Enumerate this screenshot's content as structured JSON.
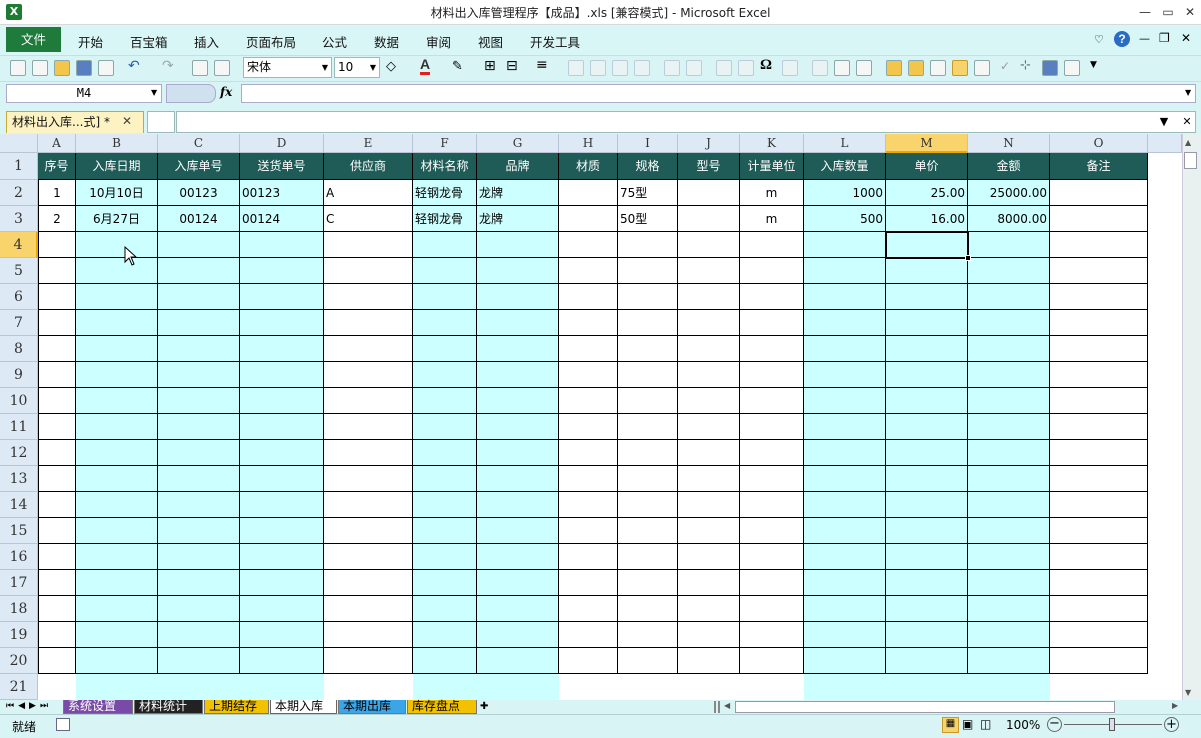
{
  "window": {
    "title": "材料出入库管理程序【成品】.xls  [兼容模式]  -  Microsoft Excel",
    "app_icon": "X"
  },
  "menu": {
    "file": "文件",
    "items": [
      "开始",
      "百宝箱",
      "插入",
      "页面布局",
      "公式",
      "数据",
      "审阅",
      "视图",
      "开发工具"
    ]
  },
  "toolbar": {
    "font_name": "宋体",
    "font_size": "10"
  },
  "formula_bar": {
    "name_box": "M4",
    "fx": "fx",
    "formula": ""
  },
  "workbook_tab": {
    "label": "材料出入库...式] *",
    "close": "✕"
  },
  "columns": [
    "A",
    "B",
    "C",
    "D",
    "E",
    "F",
    "G",
    "H",
    "I",
    "J",
    "K",
    "L",
    "M",
    "N",
    "O"
  ],
  "headers": [
    "序号",
    "入库日期",
    "入库单号",
    "送货单号",
    "供应商",
    "材料名称",
    "品牌",
    "材质",
    "规格",
    "型号",
    "计量单位",
    "入库数量",
    "单价",
    "金额",
    "备注"
  ],
  "rows": [
    [
      "1",
      "10月10日",
      "00123",
      "00123",
      "A",
      "轻钢龙骨",
      "龙牌",
      "",
      "75型",
      "",
      "m",
      "1000",
      "25.00",
      "25000.00",
      ""
    ],
    [
      "2",
      "6月27日",
      "00124",
      "00124",
      "C",
      "轻钢龙骨",
      "龙牌",
      "",
      "50型",
      "",
      "m",
      "500",
      "16.00",
      "8000.00",
      ""
    ]
  ],
  "row_numbers": [
    "1",
    "2",
    "3",
    "4",
    "5",
    "6",
    "7",
    "8",
    "9",
    "10",
    "11",
    "12",
    "13",
    "14",
    "15",
    "16",
    "17",
    "18",
    "19",
    "20",
    "21"
  ],
  "sheet_tabs": [
    {
      "label": "系统设置",
      "color": "#7a4aa8"
    },
    {
      "label": "材料统计",
      "color": "#222222"
    },
    {
      "label": "上期结存",
      "color": "#f2c200"
    },
    {
      "label": "本期入库",
      "color": "#ffffff"
    },
    {
      "label": "本期出库",
      "color": "#3aa6e8"
    },
    {
      "label": "库存盘点",
      "color": "#f2c200"
    }
  ],
  "status": {
    "ready": "就绪",
    "zoom": "100%"
  },
  "colors": {
    "header_bg": "#1f5b57",
    "cyan_col": "#ccffff",
    "selected_col_hdr": "#f9d36b"
  }
}
